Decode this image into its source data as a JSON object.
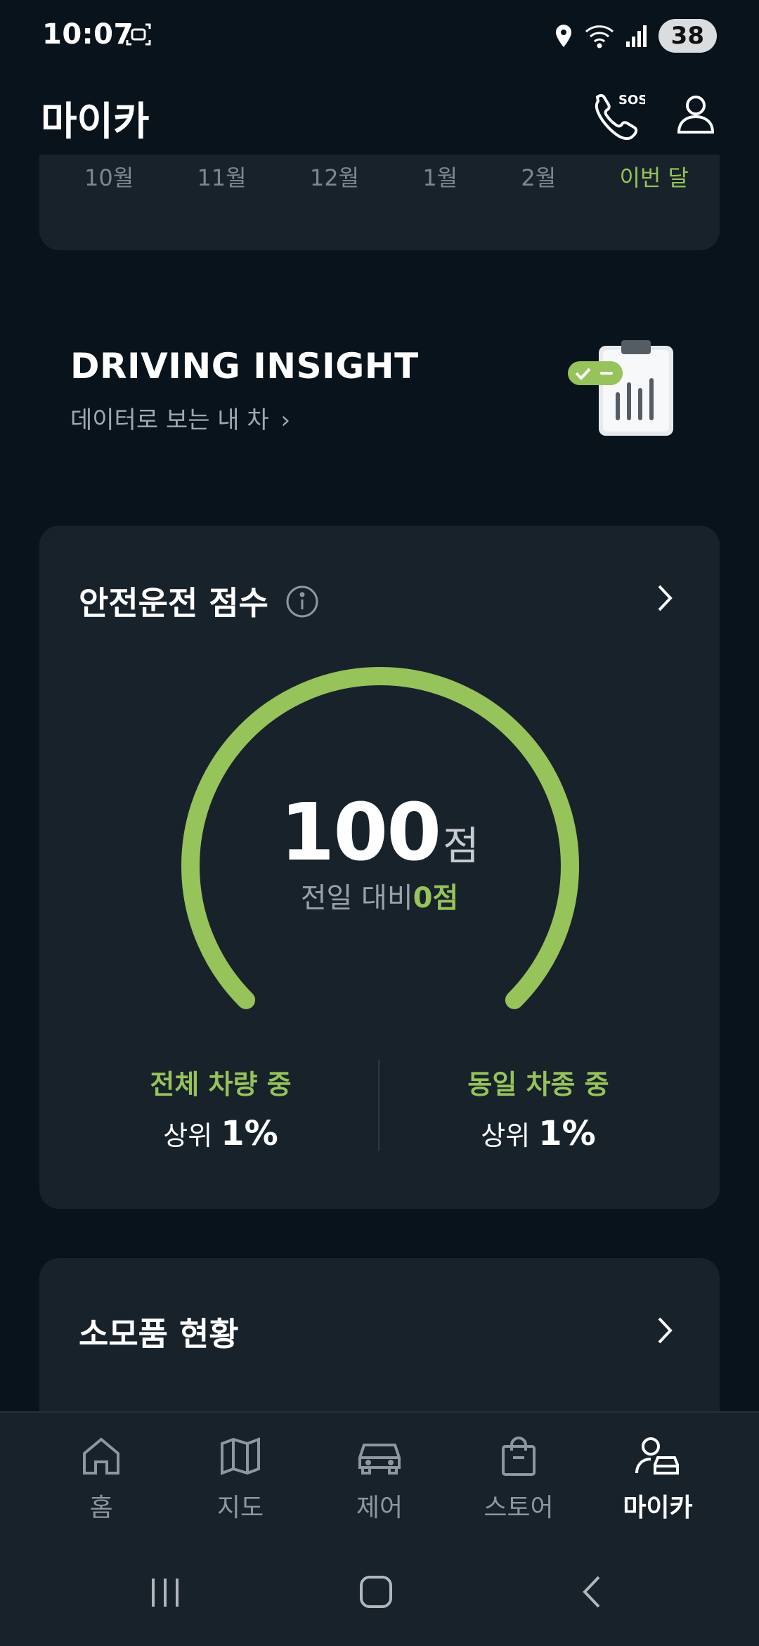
{
  "status": {
    "time": "10:07",
    "battery": "38"
  },
  "header": {
    "title": "마이카"
  },
  "months_chart": {
    "months": [
      "10월",
      "11월",
      "12월",
      "1월",
      "2월",
      "이번 달"
    ]
  },
  "insight": {
    "title": "DRIVING INSIGHT",
    "subtitle": "데이터로 보는 내 차"
  },
  "score": {
    "title": "안전운전 점수",
    "value": "100",
    "unit": "점",
    "compare_label": "전일 대비",
    "compare_value": "0점",
    "progress_fraction": 1.0,
    "rank_all_label": "전체 차량 중",
    "rank_all_prefix": "상위",
    "rank_all_value": "1%",
    "rank_same_label": "동일 차종 중",
    "rank_same_prefix": "상위",
    "rank_same_value": "1%"
  },
  "consumables": {
    "title": "소모품 현황"
  },
  "nav": {
    "home": "홈",
    "map": "지도",
    "control": "제어",
    "store": "스토어",
    "mycar": "마이카"
  },
  "colors": {
    "accent": "#96c35a",
    "card": "#18222b",
    "background": "#08131b"
  }
}
